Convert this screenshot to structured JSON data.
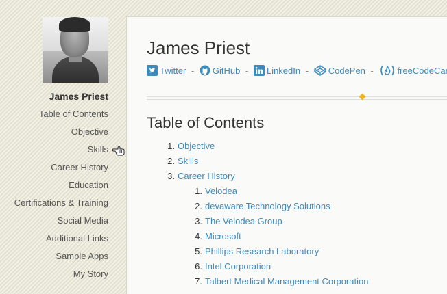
{
  "sidebar": {
    "name": "James Priest",
    "items": [
      {
        "label": "Table of Contents"
      },
      {
        "label": "Objective"
      },
      {
        "label": "Skills"
      },
      {
        "label": "Career History"
      },
      {
        "label": "Education"
      },
      {
        "label": "Certifications & Training"
      },
      {
        "label": "Social Media"
      },
      {
        "label": "Additional Links"
      },
      {
        "label": "Sample Apps"
      },
      {
        "label": "My Story"
      }
    ]
  },
  "main": {
    "title": "James Priest",
    "social": {
      "separator": "-",
      "links": [
        {
          "label": "Twitter",
          "icon": "twitter-icon"
        },
        {
          "label": "GitHub",
          "icon": "github-icon"
        },
        {
          "label": "LinkedIn",
          "icon": "linkedin-icon"
        },
        {
          "label": "CodePen",
          "icon": "codepen-icon"
        },
        {
          "label": "freeCodeCamp",
          "icon": "freecodecamp-icon"
        }
      ]
    },
    "toc": {
      "title": "Table of Contents",
      "items": [
        {
          "num": "1.",
          "label": "Objective"
        },
        {
          "num": "2.",
          "label": "Skills"
        },
        {
          "num": "3.",
          "label": "Career History"
        }
      ],
      "sub_items": [
        {
          "num": "1.",
          "label": "Velodea"
        },
        {
          "num": "2.",
          "label": "devaware Technology Solutions"
        },
        {
          "num": "3.",
          "label": "The Velodea Group"
        },
        {
          "num": "4.",
          "label": "Microsoft"
        },
        {
          "num": "5.",
          "label": "Phillips Research Laboratory"
        },
        {
          "num": "6.",
          "label": "Intel Corporation"
        },
        {
          "num": "7.",
          "label": "Talbert Medical Management Corporation"
        }
      ]
    }
  },
  "colors": {
    "link": "#3e8ab8",
    "accent": "#f2b51b",
    "text": "#333333"
  }
}
